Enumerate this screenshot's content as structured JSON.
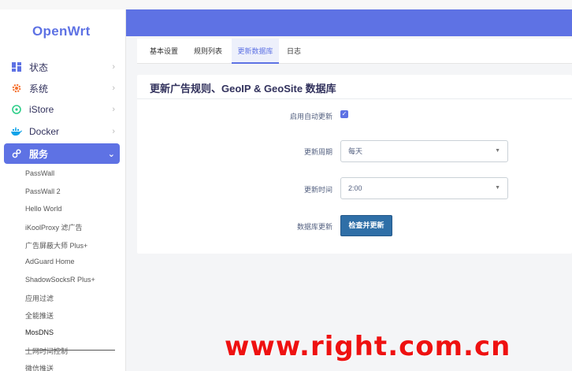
{
  "brand": "OpenWrt",
  "sidebar": {
    "items": [
      {
        "label": "状态",
        "icon": "dashboard-icon"
      },
      {
        "label": "系统",
        "icon": "gear-icon"
      },
      {
        "label": "iStore",
        "icon": "store-icon"
      },
      {
        "label": "Docker",
        "icon": "docker-icon"
      },
      {
        "label": "服务",
        "icon": "services-icon"
      }
    ],
    "subitems": [
      "PassWall",
      "PassWall 2",
      "Hello World",
      "iKoolProxy 滤广告",
      "广告屏蔽大师 Plus+",
      "AdGuard Home",
      "ShadowSocksR Plus+",
      "应用过滤",
      "全能推送",
      "MosDNS",
      "上网时间控制",
      "微信推送"
    ],
    "current_subitem": "MosDNS"
  },
  "tabs": [
    "基本设置",
    "规则列表",
    "更新数据库",
    "日志"
  ],
  "active_tab": "更新数据库",
  "card": {
    "title": "更新广告规则、GeoIP & GeoSite 数据库",
    "auto_update_label": "启用自动更新",
    "auto_update_checked": true,
    "period_label": "更新周期",
    "period_value": "每天",
    "time_label": "更新时间",
    "time_value": "2:00",
    "db_update_label": "数据库更新",
    "check_button": "检查并更新"
  },
  "watermark": "www.right.com.cn",
  "colors": {
    "accent": "#5e72e4",
    "button": "#2f6fa7",
    "watermark": "#ee1111"
  }
}
